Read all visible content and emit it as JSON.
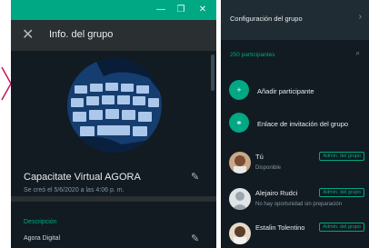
{
  "info_window": {
    "title_bar": {
      "minimize": "—",
      "maximize": "❐",
      "close": "✕"
    },
    "header": {
      "close": "✕",
      "title": "Info. del grupo"
    },
    "group": {
      "name": "Capacitate Virtual AGORA",
      "created": "Se creó el 5/6/2020 a las 4:06 p. m."
    },
    "description": {
      "label": "Descripción",
      "value": "Agora Digital"
    }
  },
  "settings_panel": {
    "header": {
      "title": "Configuración del grupo",
      "chevron": "›"
    },
    "participants_count": "250 participantes",
    "search_icon": "⌕",
    "actions": [
      {
        "icon": "add-participant-icon",
        "glyph": "+",
        "label": "Añadir participante"
      },
      {
        "icon": "link-icon",
        "glyph": "⚭",
        "label": "Enlace de invitación del grupo"
      }
    ],
    "members": [
      {
        "name": "Tú",
        "status": "Disponible",
        "badge": "Admin. del grupo"
      },
      {
        "name": "Alejairo Rudci",
        "status": "No hay oportunidad sin preparación",
        "badge": "Admin. del grupo"
      },
      {
        "name": "Estalin Tolentino",
        "status": "",
        "badge": "Admin. del grupo"
      }
    ]
  },
  "colors": {
    "accent": "#00a884",
    "panel": "#111b21",
    "window": "#2a2f32"
  }
}
